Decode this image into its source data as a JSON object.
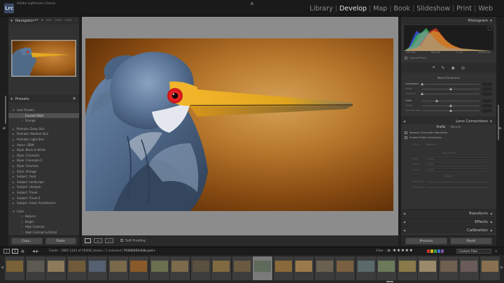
{
  "window": {
    "title": "Adobe Lightroom Classic",
    "logo_text": "Lrc"
  },
  "modules": [
    {
      "label": "Library",
      "active": false
    },
    {
      "label": "Develop",
      "active": true
    },
    {
      "label": "Map",
      "active": false
    },
    {
      "label": "Book",
      "active": false
    },
    {
      "label": "Slideshow",
      "active": false
    },
    {
      "label": "Print",
      "active": false
    },
    {
      "label": "Web",
      "active": false
    }
  ],
  "navigator": {
    "title": "Navigator",
    "zoom": {
      "fit": "FIT ≑",
      "fill": "50%",
      "one": "100%",
      "custom": "100% ÷"
    }
  },
  "presets": {
    "title": "Presets",
    "add": "+",
    "items": [
      {
        "label": "User Presets",
        "type": "group",
        "expanded": true
      },
      {
        "label": "Current Start",
        "type": "preset",
        "selected": true
      },
      {
        "label": "Grunge",
        "type": "preset"
      },
      {
        "label": "",
        "type": "gap"
      },
      {
        "label": "Portraits: Deep Skin",
        "type": "group"
      },
      {
        "label": "Portraits: Medium Skin",
        "type": "group"
      },
      {
        "label": "Portraits: Light Skin",
        "type": "group"
      },
      {
        "label": "Auto+: BBW",
        "type": "group"
      },
      {
        "label": "Style: Black & White",
        "type": "group"
      },
      {
        "label": "Style: Cinematic",
        "type": "group"
      },
      {
        "label": "Style: Cinematic II",
        "type": "group"
      },
      {
        "label": "Style: Futuristic",
        "type": "group"
      },
      {
        "label": "Style: Vintage",
        "type": "group"
      },
      {
        "label": "Subject: Food",
        "type": "group"
      },
      {
        "label": "Subject: Landscape",
        "type": "group"
      },
      {
        "label": "Subject: Lifestyle",
        "type": "group"
      },
      {
        "label": "Subject: Travel",
        "type": "group"
      },
      {
        "label": "Subject: Travel II",
        "type": "group"
      },
      {
        "label": "Subject: Urban Architecture",
        "type": "group"
      },
      {
        "label": "",
        "type": "gap"
      },
      {
        "label": "Color",
        "type": "group",
        "expanded": true
      },
      {
        "label": "Natural",
        "type": "preset"
      },
      {
        "label": "Bright",
        "type": "preset"
      },
      {
        "label": "High Contrast",
        "type": "preset"
      },
      {
        "label": "High Contrast & Detail",
        "type": "preset"
      }
    ]
  },
  "left_buttons": {
    "copy": "Copy...",
    "paste": "Paste"
  },
  "toolbar": {
    "soft_proofing": "Soft Proofing",
    "before_after_1": "Y|Y",
    "before_after_2": "Y Y"
  },
  "histogram": {
    "title": "Histogram",
    "stats": {
      "iso": "ISO 200",
      "focal": "600 mm",
      "aperture": "f / 5.6",
      "shutter": "1/3200 sec"
    },
    "original_photo": "Original Photo"
  },
  "noise_reduction": {
    "title": "Noise Reduction",
    "sliders": [
      {
        "label": "Luminance",
        "value": 0,
        "bright": true
      },
      {
        "label": "Detail",
        "value": 50,
        "bright": false
      },
      {
        "label": "Contrast",
        "value": 0,
        "bright": false
      },
      {
        "label": "Color",
        "value": 25,
        "bright": true
      },
      {
        "label": "Detail",
        "value": 50,
        "bright": false
      },
      {
        "label": "Smoothness",
        "value": 50,
        "bright": false
      }
    ]
  },
  "lens_corrections": {
    "title": "Lens Corrections",
    "tabs": {
      "profile": "Profile",
      "manual": "Manual"
    },
    "remove_ca": "Remove Chromatic Aberration",
    "enable_profile": "Enable Profile Corrections",
    "setup_label": "Setup",
    "setup_value": "Default ÷",
    "lens_profile_title": "Lens Profile",
    "make": {
      "label": "Make",
      "value": "None"
    },
    "model": {
      "label": "Model",
      "value": "None"
    },
    "profile": {
      "label": "Profile",
      "value": "None"
    },
    "amount_title": "Amount",
    "distortion": "Distortion",
    "vignetting": "Vignetting"
  },
  "right_panels": {
    "transform": "Transform",
    "effects": "Effects",
    "calibration": "Calibration"
  },
  "right_buttons": {
    "previous": "Previous",
    "reset": "Reset"
  },
  "filmstrip_bar": {
    "page1": "1",
    "page2": "2",
    "folder_label": "Folder : DMD",
    "count": "1444 of 95608 photos / 1 selected /",
    "file": "P1000459-Edit.psd",
    "filter_label": "Filter :",
    "stars": "≥ ★★★★★",
    "custom_filter": "Custom Filter"
  },
  "colors": {
    "accent_label": "#e6e6e6",
    "swatch_red": "#c0392b",
    "swatch_yellow": "#d4b21d",
    "swatch_green": "#3d9a40",
    "swatch_blue": "#3a6fc4",
    "swatch_purple": "#7a4ea3"
  }
}
